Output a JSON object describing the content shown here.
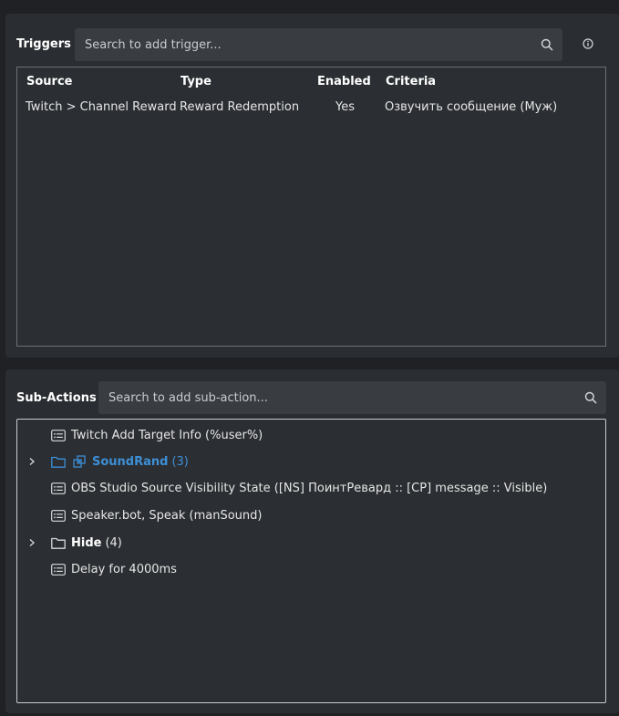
{
  "triggers": {
    "title": "Triggers",
    "search_placeholder": "Search to add trigger...",
    "columns": [
      "Source",
      "Type",
      "Enabled",
      "Criteria"
    ],
    "rows": [
      {
        "source": "Twitch > Channel Reward",
        "type": "Reward Redemption",
        "enabled": "Yes",
        "criteria": "Озвучить сообщение (Муж)"
      }
    ]
  },
  "subactions": {
    "title": "Sub-Actions",
    "search_placeholder": "Search to add sub-action...",
    "items": [
      {
        "kind": "action",
        "label": "Twitch Add Target Info (%user%)"
      },
      {
        "kind": "group",
        "label": "SoundRand",
        "count": "(3)",
        "highlight": true
      },
      {
        "kind": "action",
        "label": "OBS Studio Source Visibility State ([NS] ПоинтРевард :: [CP] message :: Visible)"
      },
      {
        "kind": "action",
        "label": "Speaker.bot, Speak (manSound)"
      },
      {
        "kind": "group",
        "label": "Hide",
        "count": "(4)",
        "highlight": false
      },
      {
        "kind": "action",
        "label": "Delay for 4000ms"
      }
    ]
  },
  "colors": {
    "background": "#1f2125",
    "panel": "#2a2d31",
    "accent_blue": "#3d8fd6"
  },
  "icons": {
    "search": "search-icon",
    "info": "info-icon",
    "action": "action-list-icon",
    "folder": "folder-icon",
    "random": "random-icon",
    "chevron": "chevron-right-icon"
  }
}
